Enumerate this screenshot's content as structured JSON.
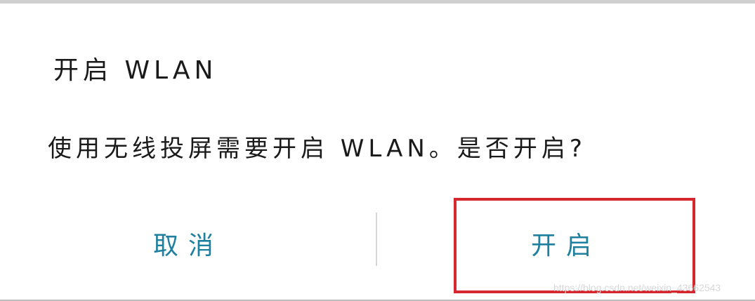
{
  "dialog": {
    "title": "开启 WLAN",
    "message": "使用无线投屏需要开启 WLAN。是否开启?",
    "buttons": {
      "cancel_label": "取消",
      "open_label": "开启"
    }
  },
  "watermark": {
    "text": "https://blog.csdn.net/weixin_43662543"
  },
  "colors": {
    "button_text": "#1e7f9e",
    "highlight_border": "#d6262e",
    "divider": "#d6d6d6"
  }
}
